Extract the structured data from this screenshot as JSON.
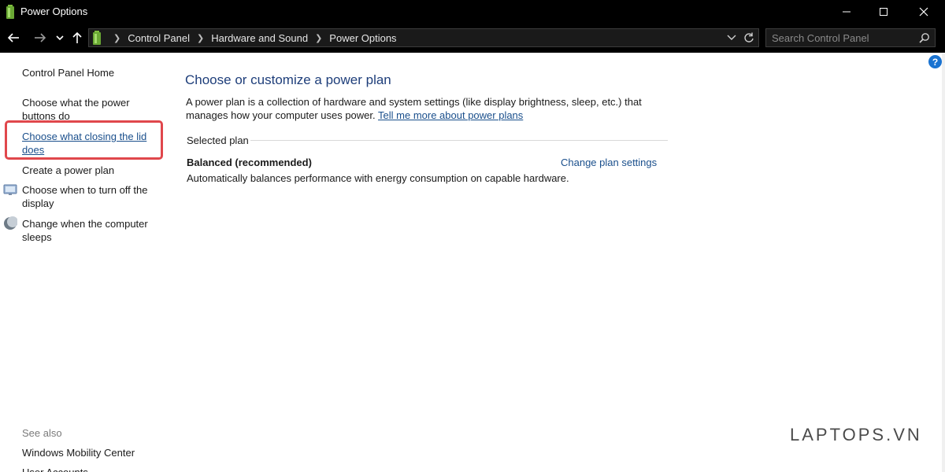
{
  "window": {
    "title": "Power Options"
  },
  "address": {
    "crumbs": [
      "Control Panel",
      "Hardware and Sound",
      "Power Options"
    ]
  },
  "search": {
    "placeholder": "Search Control Panel"
  },
  "sidebar": {
    "home": "Control Panel Home",
    "items": [
      {
        "label": "Choose what the power buttons do"
      },
      {
        "label": "Choose what closing the lid does"
      },
      {
        "label": "Create a power plan"
      },
      {
        "label": "Choose when to turn off the display"
      },
      {
        "label": "Change when the computer sleeps"
      }
    ],
    "see_also_label": "See also",
    "see_also": [
      {
        "label": "Windows Mobility Center"
      },
      {
        "label": "User Accounts"
      }
    ]
  },
  "main": {
    "title": "Choose or customize a power plan",
    "description": "A power plan is a collection of hardware and system settings (like display brightness, sleep, etc.) that manages how your computer uses power.",
    "learn_more_link": "Tell me more about power plans",
    "selected_plan_label": "Selected plan",
    "plan_name": "Balanced (recommended)",
    "change_plan_link": "Change plan settings",
    "plan_description": "Automatically balances performance with energy consumption on capable hardware."
  },
  "help": {
    "label": "?"
  },
  "watermark": "LAPTOPS.VN",
  "colors": {
    "link": "#1a4f8c",
    "title": "#1e3e7a",
    "highlight": "#e0474c",
    "titlebar": "#000000"
  }
}
